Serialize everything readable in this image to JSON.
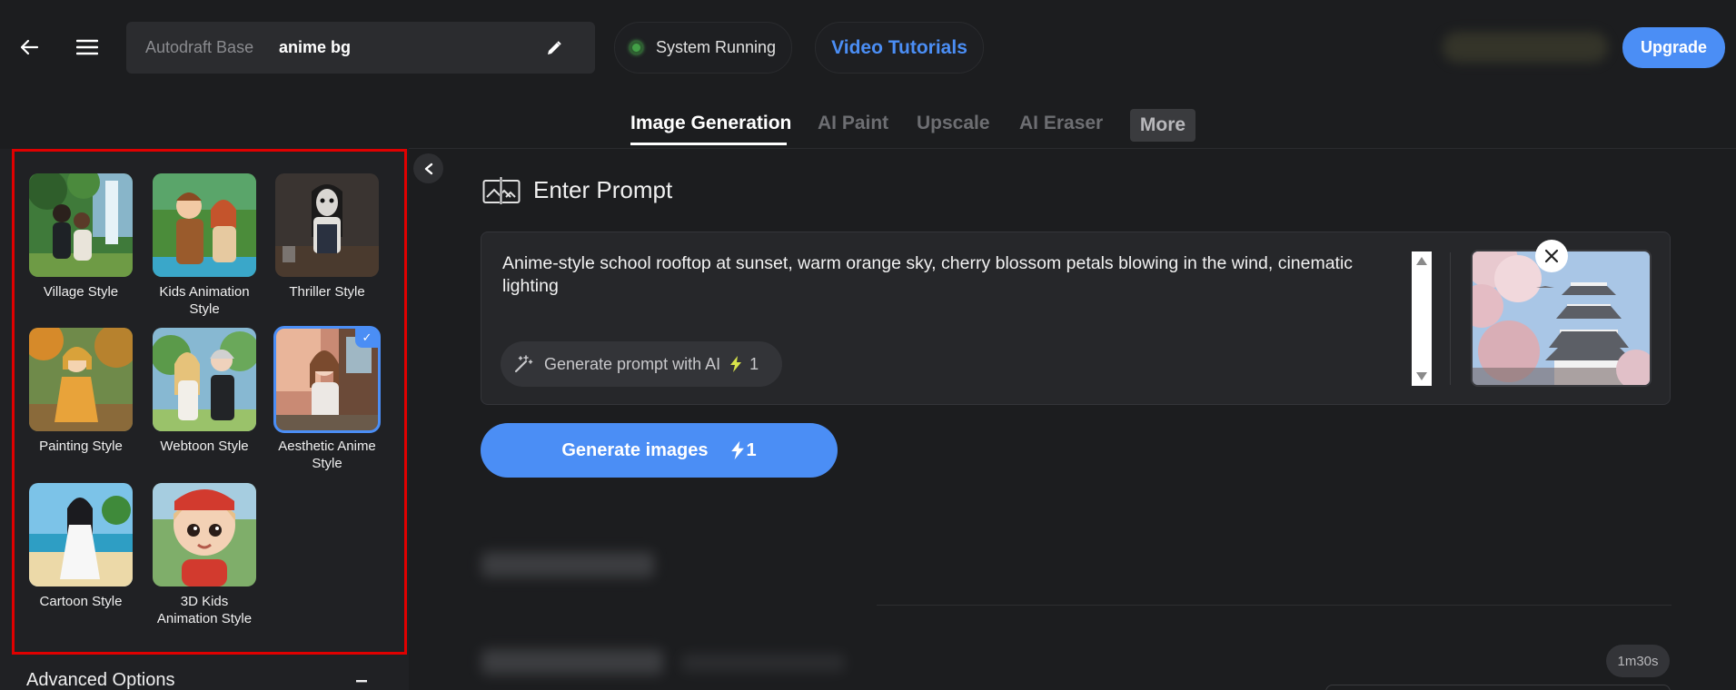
{
  "header": {
    "project_base": "Autodraft Base",
    "project_name": "anime bg",
    "status_text": "System Running",
    "tutorials_label": "Video Tutorials",
    "upgrade_label": "Upgrade"
  },
  "tabs": [
    {
      "label": "Image Generation",
      "active": true
    },
    {
      "label": "AI Paint",
      "active": false
    },
    {
      "label": "Upscale",
      "active": false
    },
    {
      "label": "AI Eraser",
      "active": false
    },
    {
      "label": "More",
      "active": false
    }
  ],
  "styles": [
    {
      "label": "Village Style",
      "selected": false
    },
    {
      "label": "Kids Animation Style",
      "selected": false
    },
    {
      "label": "Thriller Style",
      "selected": false
    },
    {
      "label": "Painting Style",
      "selected": false
    },
    {
      "label": "Webtoon Style",
      "selected": false
    },
    {
      "label": "Aesthetic Anime Style",
      "selected": true
    },
    {
      "label": "Cartoon Style",
      "selected": false
    },
    {
      "label": "3D Kids Animation Style",
      "selected": false
    }
  ],
  "advanced": {
    "title": "Advanced Options",
    "toggle": "−"
  },
  "prompt": {
    "heading": "Enter Prompt",
    "text": "Anime-style school rooftop at sunset, warm orange sky, cherry blossom petals blowing in the wind, cinematic lighting",
    "gen_ai_label": "Generate prompt with AI",
    "gen_ai_cost": "1"
  },
  "generate": {
    "label": "Generate images",
    "cost": "1"
  },
  "timer": "1m30s",
  "colors": {
    "accent": "#4b8ef5",
    "status_green": "#43a047",
    "highlight_frame": "#e00000",
    "bolt": "#d7e34a"
  }
}
